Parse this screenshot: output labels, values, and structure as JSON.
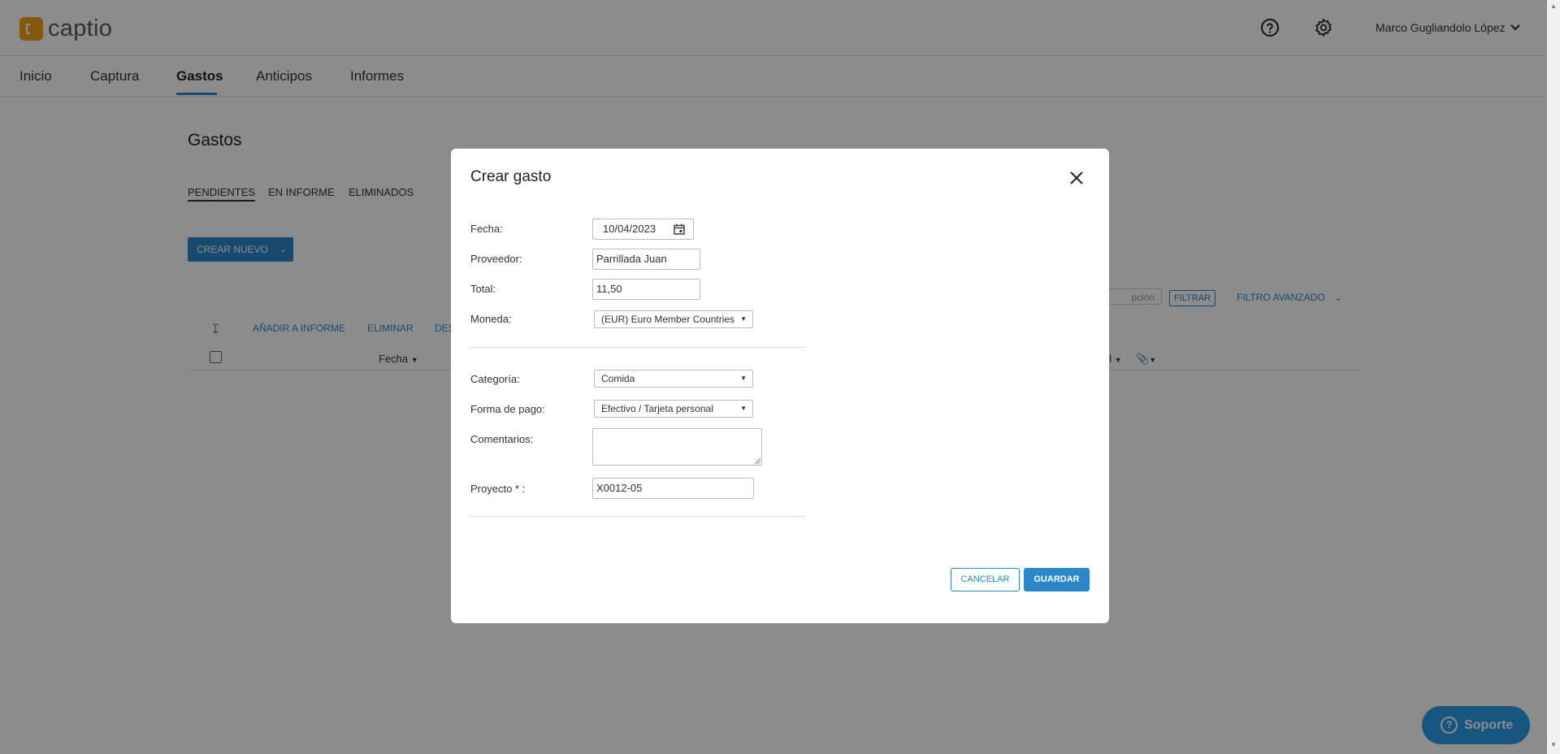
{
  "app": {
    "logo_text": "captio",
    "user_name": "Marco Gugliandolo López"
  },
  "header": {
    "help_icon": "help-circle-icon",
    "settings_icon": "gear-icon"
  },
  "nav": {
    "items": [
      {
        "label": "Inicio"
      },
      {
        "label": "Captura"
      },
      {
        "label": "Gastos",
        "active": true
      },
      {
        "label": "Anticipos"
      },
      {
        "label": "Informes"
      }
    ]
  },
  "page": {
    "title": "Gastos",
    "subtabs": [
      {
        "label": "PENDIENTES",
        "active": true
      },
      {
        "label": "EN INFORME"
      },
      {
        "label": "ELIMINADOS"
      }
    ],
    "create_button": "CREAR NUEVO",
    "actions": [
      "AÑADIR A INFORME",
      "ELIMINAR",
      "DES"
    ],
    "col_fecha": "Fecha",
    "col_total_partial": "al",
    "filter_placeholder": "pción",
    "filter_button": "FILTRAR",
    "advanced_filter": "FILTRO AVANZADO"
  },
  "modal": {
    "title": "Crear gasto",
    "fields": {
      "fecha": {
        "label": "Fecha:",
        "value": "10/04/2023"
      },
      "proveedor": {
        "label": "Proveedor:",
        "value": "Parrillada Juan"
      },
      "total": {
        "label": "Total:",
        "value": "11,50"
      },
      "moneda": {
        "label": "Moneda:",
        "value": "(EUR) Euro Member Countries"
      },
      "categoria": {
        "label": "Categoría:",
        "value": "Comida"
      },
      "forma_pago": {
        "label": "Forma de pago:",
        "value": "Efectivo / Tarjeta personal"
      },
      "comentarios": {
        "label": "Comentarios:",
        "value": ""
      },
      "proyecto": {
        "label": "Proyecto * :",
        "value": "X0012-05"
      }
    },
    "cancel_button": "CANCELAR",
    "save_button": "GUARDAR"
  },
  "support": {
    "label": "Soporte"
  },
  "colors": {
    "accent": "#2b87c8",
    "logo": "#f0a21b",
    "support": "#2b9fe8"
  }
}
